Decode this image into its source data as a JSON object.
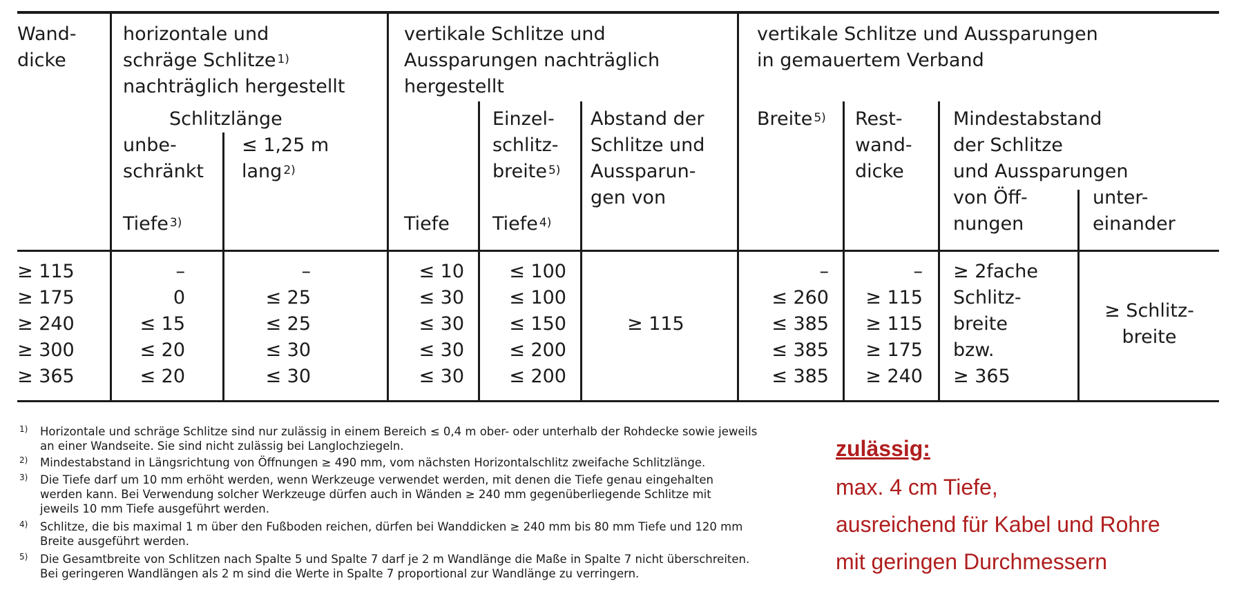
{
  "header": {
    "col1": [
      "Wand-",
      "dicke"
    ],
    "col2_title": [
      "horizontale und",
      "schräge Schlitze",
      "nachträglich hergestellt"
    ],
    "col2_title_sup": "1)",
    "col2_sub": "Schlitzlänge",
    "col2a": [
      "unbe-",
      "schränkt"
    ],
    "col2b": [
      "≤ 1,25 m",
      "lang"
    ],
    "col2b_sup": "2)",
    "tiefe": "Tiefe",
    "sup3": "3)",
    "sup4": "4)",
    "sup5": "5)",
    "col3_title": [
      "vertikale Schlitze und",
      "Aussparungen nachträglich",
      "hergestellt"
    ],
    "col3b": [
      "Einzel-",
      "schlitz-",
      "breite"
    ],
    "col3c": [
      "Abstand der",
      "Schlitze und",
      "Aussparun-",
      "gen von"
    ],
    "col4_title": [
      "vertikale Schlitze und Aussparungen",
      "in gemauertem Verband"
    ],
    "col4a": "Breite",
    "col4b": [
      "Rest-",
      "wand-",
      "dicke"
    ],
    "col4c": [
      "Mindestabstand",
      "der Schlitze",
      "und Aussparungen"
    ],
    "col4c1": [
      "von Öff-",
      "nungen"
    ],
    "col4c2": [
      "unter-",
      "einander"
    ]
  },
  "rows": {
    "wanddicke": [
      "≥ 115",
      "≥ 175",
      "≥ 240",
      "≥ 300",
      "≥ 365"
    ],
    "tiefe_unbeschraenkt": [
      "–",
      "0",
      "≤ 15",
      "≤ 20",
      "≤ 20"
    ],
    "tiefe_lang": [
      "–",
      "≤ 25",
      "≤ 25",
      "≤ 30",
      "≤ 30"
    ],
    "vert_tiefe": [
      "≤ 10",
      "≤ 30",
      "≤ 30",
      "≤ 30",
      "≤ 30"
    ],
    "einzelschlitzbreite": [
      "≤ 100",
      "≤ 100",
      "≤ 150",
      "≤ 200",
      "≤ 200"
    ],
    "abstand": "≥ 115",
    "breite": [
      "–",
      "≤ 260",
      "≤ 385",
      "≤ 385",
      "≤ 385"
    ],
    "restwanddicke": [
      "–",
      "≥ 115",
      "≥ 115",
      "≥ 175",
      "≥ 240"
    ],
    "von_oeffnungen": [
      "≥ 2fache",
      "Schlitz-",
      "breite",
      "bzw.",
      "≥ 365"
    ],
    "untereinander": [
      "≥ Schlitz-",
      "breite"
    ]
  },
  "footnotes": [
    {
      "num": "1)",
      "lines": [
        "Horizontale und schräge Schlitze sind nur zulässig in einem Bereich ≤ 0,4 m ober- oder unterhalb der Rohdecke sowie jeweils",
        "an einer Wandseite. Sie sind nicht zulässig bei Langlochziegeln."
      ]
    },
    {
      "num": "2)",
      "lines": [
        "Mindestabstand in Längsrichtung von Öffnungen ≥ 490 mm, vom nächsten Horizontalschlitz zweifache Schlitzlänge."
      ]
    },
    {
      "num": "3)",
      "lines": [
        "Die Tiefe darf um 10 mm erhöht werden, wenn Werkzeuge verwendet werden, mit denen die Tiefe genau eingehalten",
        "werden kann. Bei Verwendung solcher Werkzeuge dürfen auch in Wänden ≥ 240 mm gegenüberliegende Schlitze mit",
        "jeweils 10 mm Tiefe ausgeführt werden."
      ]
    },
    {
      "num": "4)",
      "lines": [
        "Schlitze, die bis maximal 1 m über den Fußboden reichen, dürfen bei Wanddicken ≥ 240 mm bis 80 mm Tiefe und 120 mm",
        "Breite ausgeführt werden."
      ]
    },
    {
      "num": "5)",
      "lines": [
        "Die Gesamtbreite von Schlitzen nach Spalte 5 und Spalte 7 darf je 2 m Wandlänge die Maße in Spalte 7 nicht überschreiten.",
        "Bei geringeren Wandlängen als 2 m sind die Werte in Spalte 7 proportional zur Wandlänge zu verringern."
      ]
    }
  ],
  "note": {
    "title": "zulässig:",
    "lines": [
      "max. 4 cm Tiefe,",
      "ausreichend für Kabel und Rohre",
      "mit geringen Durchmessern"
    ]
  }
}
